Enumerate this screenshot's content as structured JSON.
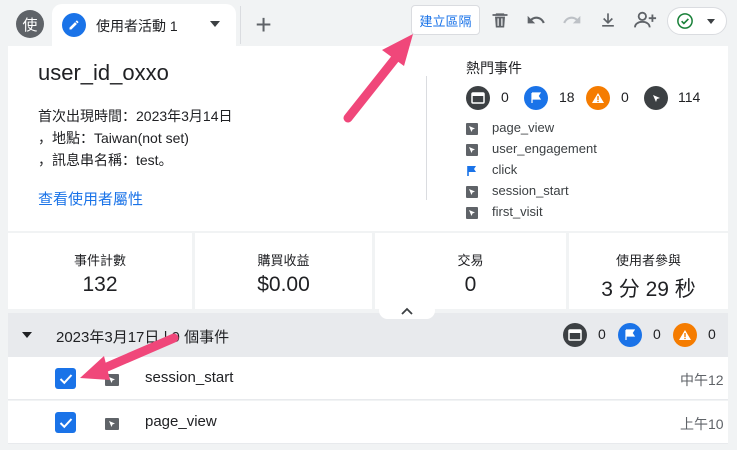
{
  "app": {
    "avatar_letter": "使",
    "tab_label": "使用者活動 1",
    "segment_button": "建立區隔"
  },
  "icons": {
    "tab": "pencil-icon",
    "add": "plus-icon",
    "delete": "trash-icon",
    "undo": "undo-icon",
    "redo": "redo-icon",
    "download": "download-icon",
    "share": "add-person-icon",
    "status": "check-circle-icon"
  },
  "colors": {
    "accent": "#1a73e8",
    "warning": "#f57c00",
    "dark": "#3c4043",
    "highlight_arrow": "#f0477a"
  },
  "user": {
    "id": "user_id_oxxo",
    "first_seen": "首次出現時間：2023年3月14日",
    "location": "，地點：Taiwan(not set)",
    "stream": "，訊息串名稱：test。",
    "attr_link": "查看使用者屬性"
  },
  "top_events": {
    "title": "熱門事件",
    "counts": {
      "screen": "0",
      "conversion": "18",
      "error": "0",
      "other": "114"
    },
    "items": [
      {
        "label": "page_view",
        "icon": "cursor-icon"
      },
      {
        "label": "user_engagement",
        "icon": "cursor-icon"
      },
      {
        "label": "click",
        "icon": "flag-icon"
      },
      {
        "label": "session_start",
        "icon": "cursor-icon"
      },
      {
        "label": "first_visit",
        "icon": "cursor-icon"
      }
    ]
  },
  "metrics": [
    {
      "label": "事件計數",
      "value": "132"
    },
    {
      "label": "購買收益",
      "value": "$0.00"
    },
    {
      "label": "交易",
      "value": "0"
    },
    {
      "label": "使用者參與",
      "value": "3 分 29 秒"
    }
  ],
  "group": {
    "title": "2023年3月17日 | 9 個事件",
    "counts": {
      "screen": "0",
      "conversion": "0",
      "error": "0"
    }
  },
  "rows": [
    {
      "label": "session_start",
      "time": "中午12",
      "checked": true
    },
    {
      "label": "page_view",
      "time": "上午10",
      "checked": true
    }
  ]
}
